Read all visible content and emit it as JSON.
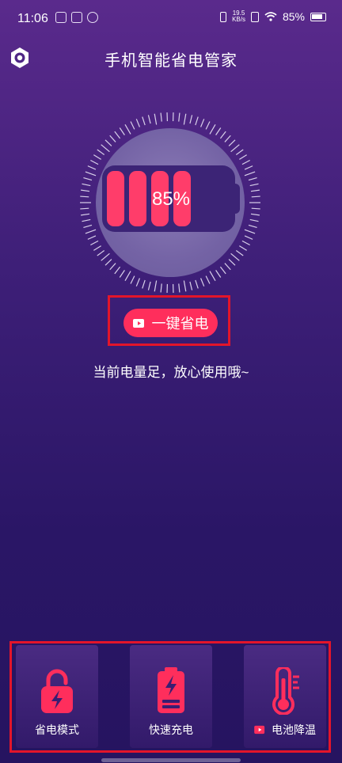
{
  "status_bar": {
    "time": "11:06",
    "net_speed_value": "19.5",
    "net_speed_unit": "KB/s",
    "battery_percent": "85%"
  },
  "header": {
    "title": "手机智能省电管家"
  },
  "gauge": {
    "battery_level": 0.85,
    "percent_label": "85%"
  },
  "action": {
    "save_button_label": "一键省电"
  },
  "tagline": "当前电量足，放心使用哦~",
  "cards": [
    {
      "label": "省电模式",
      "icon": "lock-bolt-icon"
    },
    {
      "label": "快速充电",
      "icon": "battery-charge-icon"
    },
    {
      "label": "电池降温",
      "icon": "thermometer-icon"
    }
  ],
  "colors": {
    "accent": "#ff2e5c",
    "highlight_box": "#e3152a",
    "background_top": "#5a2a8c",
    "background_bottom": "#261460"
  }
}
